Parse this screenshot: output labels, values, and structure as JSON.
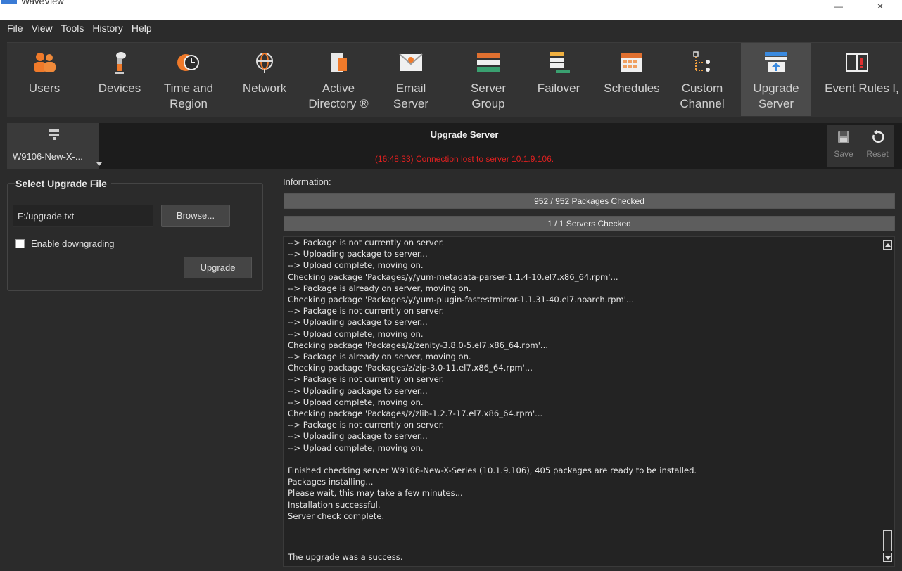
{
  "window": {
    "title": "WaveView",
    "minimize": "—",
    "close": "✕"
  },
  "menu": [
    "File",
    "View",
    "Tools",
    "History",
    "Help"
  ],
  "toolbar": [
    {
      "label": "Users",
      "icon": "users-icon"
    },
    {
      "label": "Devices",
      "icon": "camera-icon"
    },
    {
      "label": "Time and\nRegion",
      "icon": "clock-globe-icon"
    },
    {
      "label": "Network",
      "icon": "network-globe-icon"
    },
    {
      "label": "Active\nDirectory ®",
      "icon": "directory-icon"
    },
    {
      "label": "Email\nServer",
      "icon": "envelope-icon"
    },
    {
      "label": "Server\nGroup",
      "icon": "server-group-icon"
    },
    {
      "label": "Failover",
      "icon": "failover-icon"
    },
    {
      "label": "Schedules",
      "icon": "calendar-icon"
    },
    {
      "label": "Custom\nChannel",
      "icon": "custom-channel-icon"
    },
    {
      "label": "Upgrade\nServer",
      "icon": "upgrade-server-icon",
      "active": true
    },
    {
      "label": "Event Rules",
      "icon": "book-icon"
    },
    {
      "label": "I,",
      "icon": ""
    }
  ],
  "server_selector": {
    "label": "W9106-New-X-..."
  },
  "header": {
    "title": "Upgrade Server",
    "status": "(16:48:33) Connection lost to server 10.1.9.106.",
    "save_label": "Save",
    "reset_label": "Reset"
  },
  "left": {
    "group_title": "Select Upgrade File",
    "file_value": "F:/upgrade.txt",
    "browse_label": "Browse...",
    "downgrade_label": "Enable downgrading",
    "downgrade_checked": false,
    "upgrade_label": "Upgrade"
  },
  "right": {
    "info_label": "Information:",
    "packages_progress": {
      "text": "952 / 952 Packages Checked",
      "fraction": 1.0
    },
    "servers_progress": {
      "text": "1 / 1 Servers Checked",
      "fraction": 1.0
    }
  },
  "log": {
    "lines": "--> Package is not currently on server.\n--> Uploading package to server...\n--> Upload complete, moving on.\nChecking package 'Packages/y/yum-metadata-parser-1.1.4-10.el7.x86_64.rpm'...\n--> Package is already on server, moving on.\nChecking package 'Packages/y/yum-plugin-fastestmirror-1.1.31-40.el7.noarch.rpm'...\n--> Package is not currently on server.\n--> Uploading package to server...\n--> Upload complete, moving on.\nChecking package 'Packages/z/zenity-3.8.0-5.el7.x86_64.rpm'...\n--> Package is already on server, moving on.\nChecking package 'Packages/z/zip-3.0-11.el7.x86_64.rpm'...\n--> Package is not currently on server.\n--> Uploading package to server...\n--> Upload complete, moving on.\nChecking package 'Packages/z/zlib-1.2.7-17.el7.x86_64.rpm'...\n--> Package is not currently on server.\n--> Uploading package to server...\n--> Upload complete, moving on.\n\nFinished checking server W9106-New-X-Series (10.1.9.106), 405 packages are ready to be installed.\nPackages installing...\nPlease wait, this may take a few minutes...\nInstallation successful.\nServer check complete.",
    "final": "The upgrade was a success."
  },
  "colors": {
    "status_error": "#e02020",
    "accent_orange": "#f07a2a",
    "background": "#2b2b2b"
  }
}
